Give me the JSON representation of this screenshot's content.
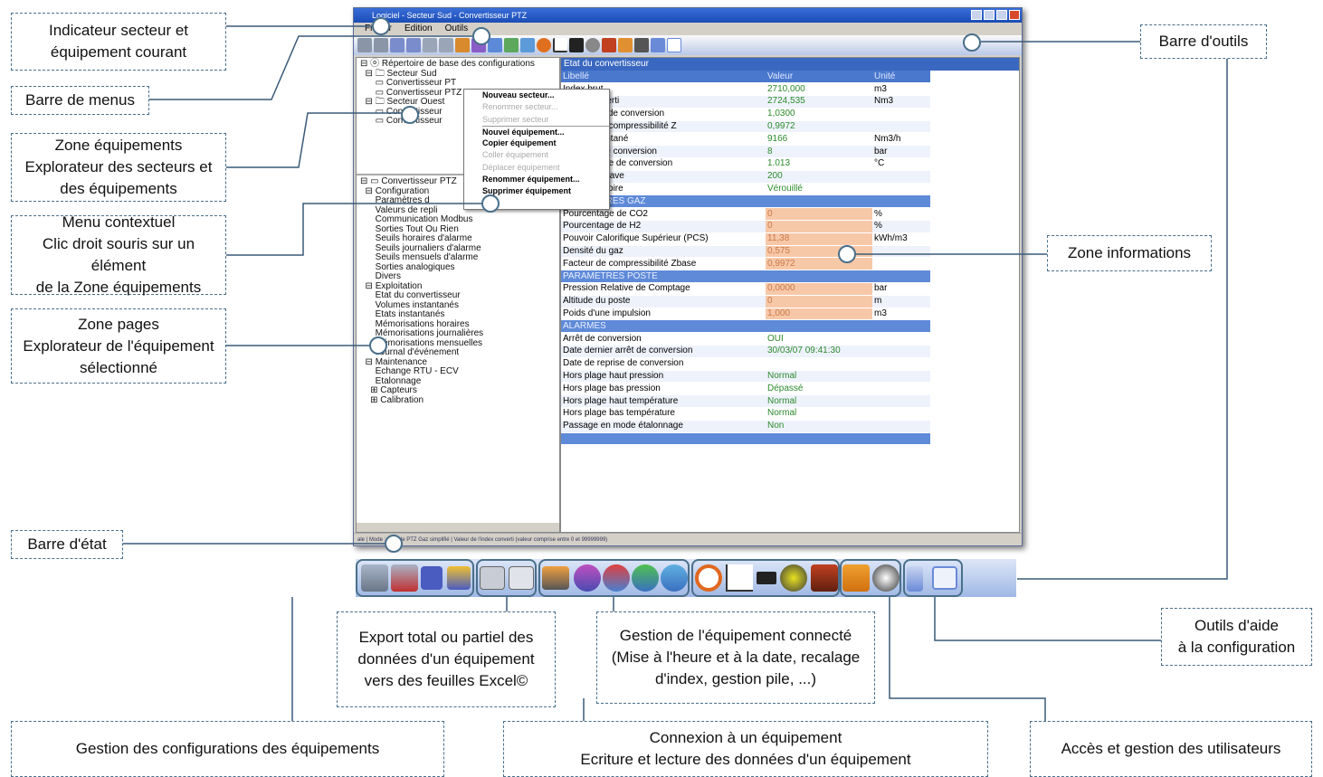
{
  "window": {
    "title": "Logiciel - Secteur Sud - Convertisseur PTZ",
    "menus": [
      "Fichier",
      "Edition",
      "Outils"
    ]
  },
  "tree_top": [
    "⊟ ⓞ Répertoire de base des configurations",
    "  ⊟ 🗀 Secteur Sud",
    "      ▭ Convertisseur PT",
    "      ▭ Convertisseur PTZ",
    "  ⊟ 🗀 Secteur Ouest",
    "      ▭ Convertisseur",
    "      ▭ Convertisseur"
  ],
  "tree_bottom": [
    "⊟ ▭ Convertisseur PTZ",
    "  ⊟ Configuration",
    "      Paramètres d",
    "      Valeurs de repli",
    "      Communication Modbus",
    "      Sorties Tout Ou Rien",
    "      Seuils horaires d'alarme",
    "      Seuils journaliers d'alarme",
    "      Seuils mensuels d'alarme",
    "      Sorties analogiques",
    "      Divers",
    "  ⊟ Exploitation",
    "      Etat du convertisseur",
    "      Volumes instantanés",
    "      Etats instantanés",
    "      Mémorisations horaires",
    "      Mémorisations journalières",
    "      Mémorisations mensuelles",
    "      Journal d'événement",
    "  ⊟ Maintenance",
    "      Echange RTU - ECV",
    "      Etalonnage",
    "    ⊞ Capteurs",
    "    ⊞ Calibration"
  ],
  "context_menu": [
    {
      "label": "Nouveau secteur...",
      "enabled": true
    },
    {
      "label": "Renommer secteur...",
      "enabled": false
    },
    {
      "label": "Supprimer secteur",
      "enabled": false
    },
    {
      "label": "Nouvel équipement...",
      "enabled": true
    },
    {
      "label": "Copier équipement",
      "enabled": true
    },
    {
      "label": "Coller équipement",
      "enabled": false
    },
    {
      "label": "Déplacer équipement",
      "enabled": false
    },
    {
      "label": "Renommer équipement...",
      "enabled": true
    },
    {
      "label": "Supprimer équipement",
      "enabled": true
    }
  ],
  "info": {
    "title": "Etat du convertisseur",
    "headers": [
      "Libellé",
      "Valeur",
      "Unité"
    ],
    "rows": [
      [
        "Index brut",
        "2710,000",
        "m3",
        "odd"
      ],
      [
        "Index converti",
        "2724,535",
        "Nm3",
        "even"
      ],
      [
        "Coefficient de conversion",
        "1,0300",
        "",
        "odd"
      ],
      [
        "Facteur de compressibilité Z",
        "0,9972",
        "",
        "even"
      ],
      [
        "Débit instantané",
        "9166",
        "Nm3/h",
        "odd"
      ],
      [
        "Pression de conversion",
        "8",
        "bar",
        "even"
      ],
      [
        "Température de conversion",
        "1.013",
        "°C",
        "odd"
      ],
      [
        "Seuil autoclave",
        "200",
        "",
        "even"
      ],
      [
        "Mode mémoire",
        "Vérouillé",
        "",
        "odd"
      ],
      [
        "PARAMETRES GAZ",
        "",
        "",
        "sec"
      ],
      [
        "Pourcentage de CO2",
        "0",
        "%",
        "odd orange"
      ],
      [
        "Pourcentage de H2",
        "0",
        "%",
        "even orange"
      ],
      [
        "Pouvoir Calorifique Supérieur (PCS)",
        "11,38",
        "kWh/m3",
        "odd orange"
      ],
      [
        "Densité du gaz",
        "0,575",
        "",
        "even orange"
      ],
      [
        "Facteur de compressibilité Zbase",
        "0,9972",
        "",
        "odd orange"
      ],
      [
        "PARAMETRES POSTE",
        "",
        "",
        "sec"
      ],
      [
        "Pression Relative de Comptage",
        "0,0000",
        "bar",
        "odd orange"
      ],
      [
        "Altitude du poste",
        "0",
        "m",
        "even orange"
      ],
      [
        "Poids d'une impulsion",
        "1,000",
        "m3",
        "odd orange"
      ],
      [
        "ALARMES",
        "",
        "",
        "sec"
      ],
      [
        "Arrêt de conversion",
        "OUI",
        "",
        "odd"
      ],
      [
        "Date dernier arrêt de conversion",
        "30/03/07 09:41:30",
        "",
        "even"
      ],
      [
        "Date de reprise de conversion",
        "",
        "",
        "odd"
      ],
      [
        "Hors plage haut pression",
        "Normal",
        "",
        "even"
      ],
      [
        "Hors plage bas pression",
        "Dépassé",
        "",
        "odd"
      ],
      [
        "Hors plage haut température",
        "Normal",
        "",
        "even"
      ],
      [
        "Hors plage bas température",
        "Normal",
        "",
        "odd"
      ],
      [
        "Passage en mode étalonnage",
        "Non",
        "",
        "even"
      ],
      [
        "",
        "",
        "",
        "sec"
      ]
    ]
  },
  "status_text": "ale | Mode : Modèle PTZ Gaz simplifié | Valeur de l'index converti (valeur comprise entre 0 et 99999999)",
  "callouts": {
    "indicateur": "Indicateur secteur  et\néquipement courant",
    "barre_menus": "Barre de menus",
    "zone_equip": "Zone équipements\nExplorateur des secteurs et\ndes équipements",
    "menu_ctx": "Menu contextuel\nClic droit souris sur un élément\nde la Zone équipements",
    "zone_pages": "Zone pages\nExplorateur de l'équipement\nsélectionné",
    "barre_etat": "Barre d'état",
    "barre_outils": "Barre d'outils",
    "zone_info": "Zone informations",
    "export": "Export total ou partiel des\ndonnées d'un équipement\nvers des feuilles Excel©",
    "gestion_connecte": "Gestion de l'équipement connecté\n(Mise à l'heure et à la date, recalage\nd'index, gestion pile, ...)",
    "outils_aide": "Outils d'aide\nà la configuration",
    "gestion_config": "Gestion des configurations des équipements",
    "connexion": "Connexion à un équipement\nEcriture et lecture des données d'un équipement",
    "acces": "Accès et gestion des utilisateurs"
  },
  "colors": {
    "accent": "#4a6f8a",
    "header_blue": "#4a78cc",
    "value_green": "#2c8a2c",
    "cell_orange": "#f7c8a8"
  }
}
